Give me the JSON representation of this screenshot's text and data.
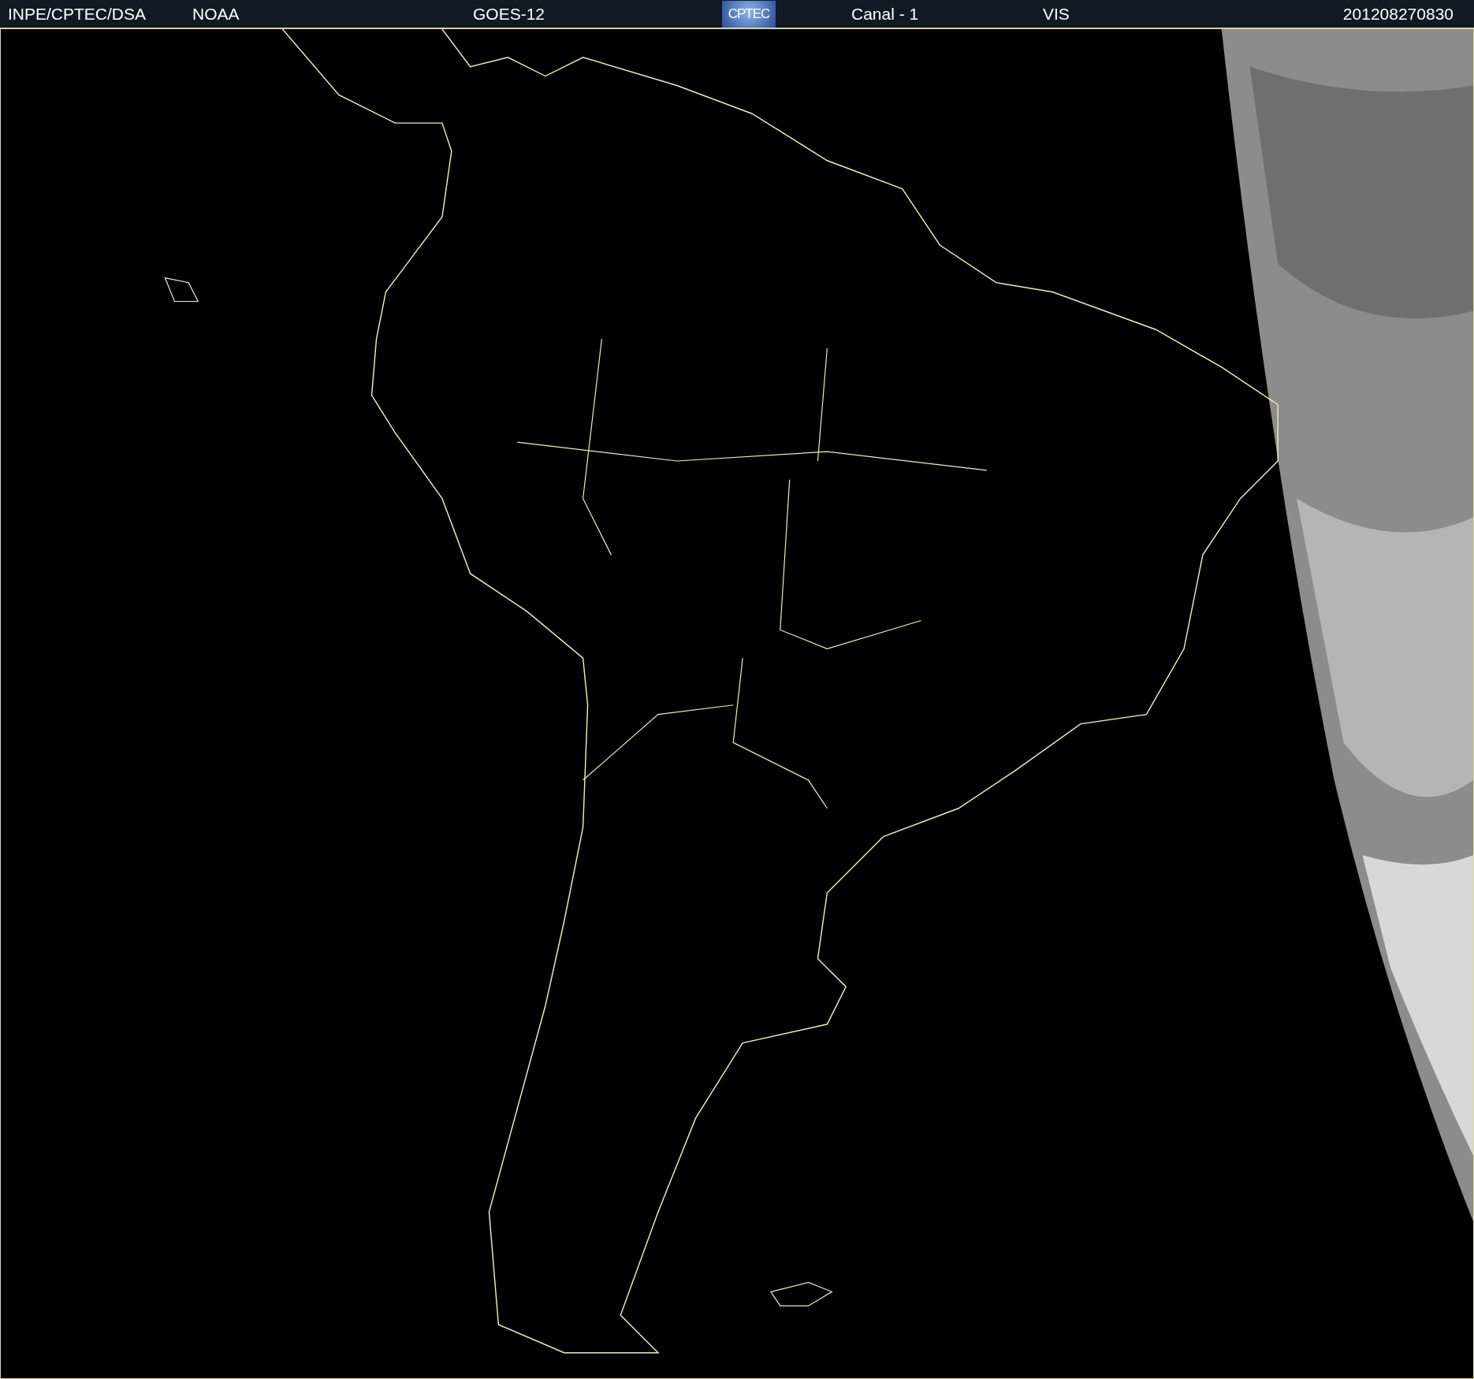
{
  "header": {
    "source": "INPE/CPTEC/DSA",
    "agency": "NOAA",
    "satellite": "GOES-12",
    "logo": "CPTEC",
    "channel": "Canal - 1",
    "band": "VIS",
    "timestamp": "201208270830"
  }
}
